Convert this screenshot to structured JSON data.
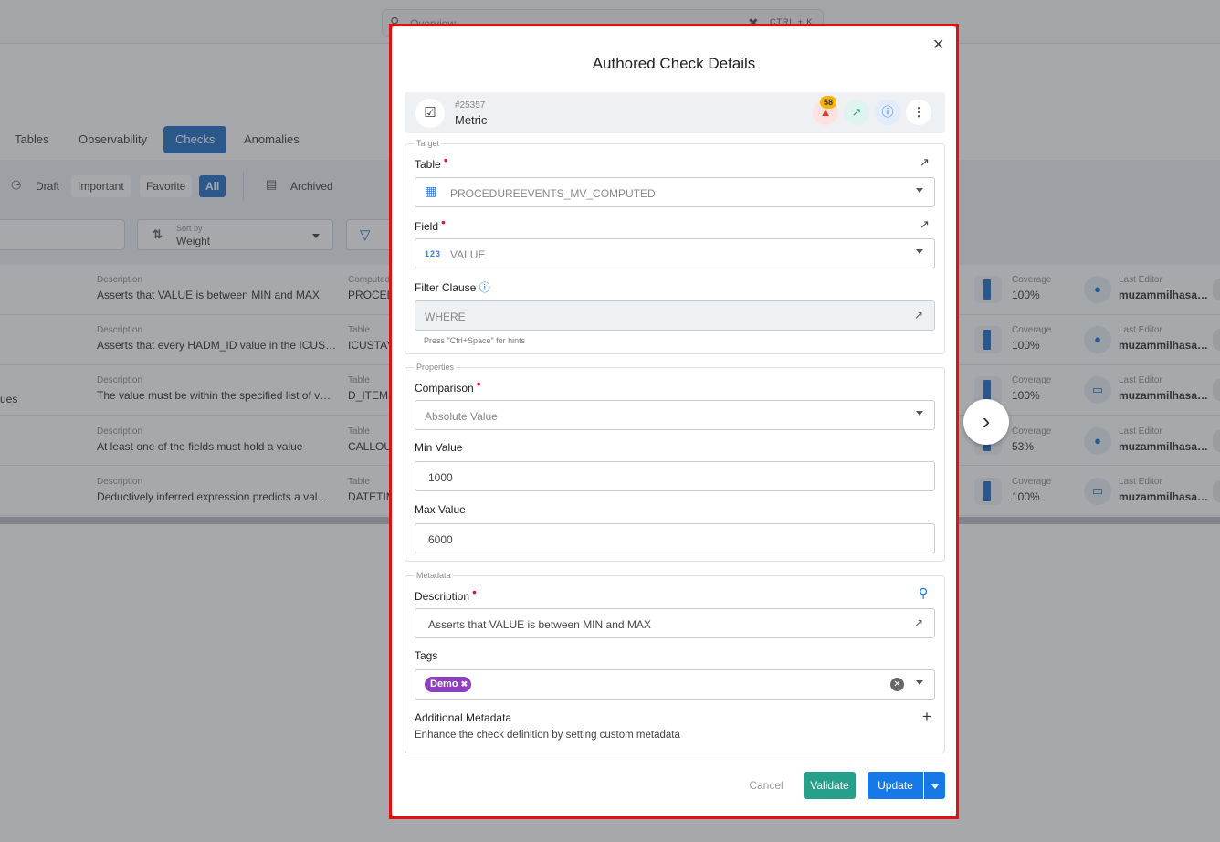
{
  "search": {
    "placeholder": "Overview",
    "shortcut": "CTRL + K"
  },
  "tabs": [
    "Tables",
    "Observability",
    "Checks",
    "Anomalies"
  ],
  "filters": {
    "chips": [
      "Draft",
      "Important",
      "Favorite",
      "All"
    ],
    "archived": "Archived",
    "sort_caption": "Sort by",
    "sort_value": "Weight"
  },
  "rows": [
    {
      "desc_label": "Description",
      "desc": "Asserts that VALUE is between MIN and MAX",
      "table_label": "Computed",
      "table": "PROCED",
      "cov_label": "Coverage",
      "cov": "100%",
      "editor_label": "Last Editor",
      "editor": "muzammilhasa…",
      "left": ""
    },
    {
      "desc_label": "Description",
      "desc": "Asserts that every HADM_ID value in the ICUS…",
      "table_label": "Table",
      "table": "ICUSTAY",
      "cov_label": "Coverage",
      "cov": "100%",
      "editor_label": "Last Editor",
      "editor": "muzammilhasa…",
      "left": ""
    },
    {
      "desc_label": "Description",
      "desc": "The value must be within the specified list of v…",
      "table_label": "Table",
      "table": "D_ITEMS",
      "cov_label": "Coverage",
      "cov": "100%",
      "editor_label": "Last Editor",
      "editor": "muzammilhasa…",
      "left": "ues"
    },
    {
      "desc_label": "Description",
      "desc": "At least one of the fields must hold a value",
      "table_label": "Table",
      "table": "CALLOU",
      "cov_label": "Coverage",
      "cov": "53%",
      "editor_label": "Last Editor",
      "editor": "muzammilhasa…",
      "left": ""
    },
    {
      "desc_label": "Description",
      "desc": "Deductively inferred expression predicts a val…",
      "table_label": "Table",
      "table": "DATETIM",
      "cov_label": "Coverage",
      "cov": "100%",
      "editor_label": "Last Editor",
      "editor": "muzammilhasa…",
      "left": ""
    }
  ],
  "modal": {
    "title": "Authored Check Details",
    "check_id": "#25357",
    "check_type": "Metric",
    "anomaly_count": "58",
    "target": {
      "legend": "Target",
      "table_label": "Table",
      "table_value": "PROCEDUREEVENTS_MV_COMPUTED",
      "field_label": "Field",
      "field_type": "123",
      "field_value": "VALUE",
      "filter_label": "Filter Clause",
      "filter_placeholder": "WHERE",
      "hint": "Press \"Ctrl+Space\" for hints"
    },
    "properties": {
      "legend": "Properties",
      "comparison_label": "Comparison",
      "comparison_value": "Absolute Value",
      "min_label": "Min Value",
      "min_value": "1000",
      "max_label": "Max Value",
      "max_value": "6000"
    },
    "metadata": {
      "legend": "Metadata",
      "description_label": "Description",
      "description_value": "Asserts that VALUE is between MIN and MAX",
      "tags_label": "Tags",
      "tag": "Demo",
      "additional_label": "Additional Metadata",
      "additional_help": "Enhance the check definition by setting custom metadata"
    },
    "buttons": {
      "cancel": "Cancel",
      "validate": "Validate",
      "update": "Update"
    }
  },
  "colors": {
    "primary": "#1565c0",
    "validate": "#26a08a",
    "update": "#1779e8",
    "tag": "#8e3fbe",
    "required": "#e0134b",
    "highlight_frame": "#e31010"
  }
}
